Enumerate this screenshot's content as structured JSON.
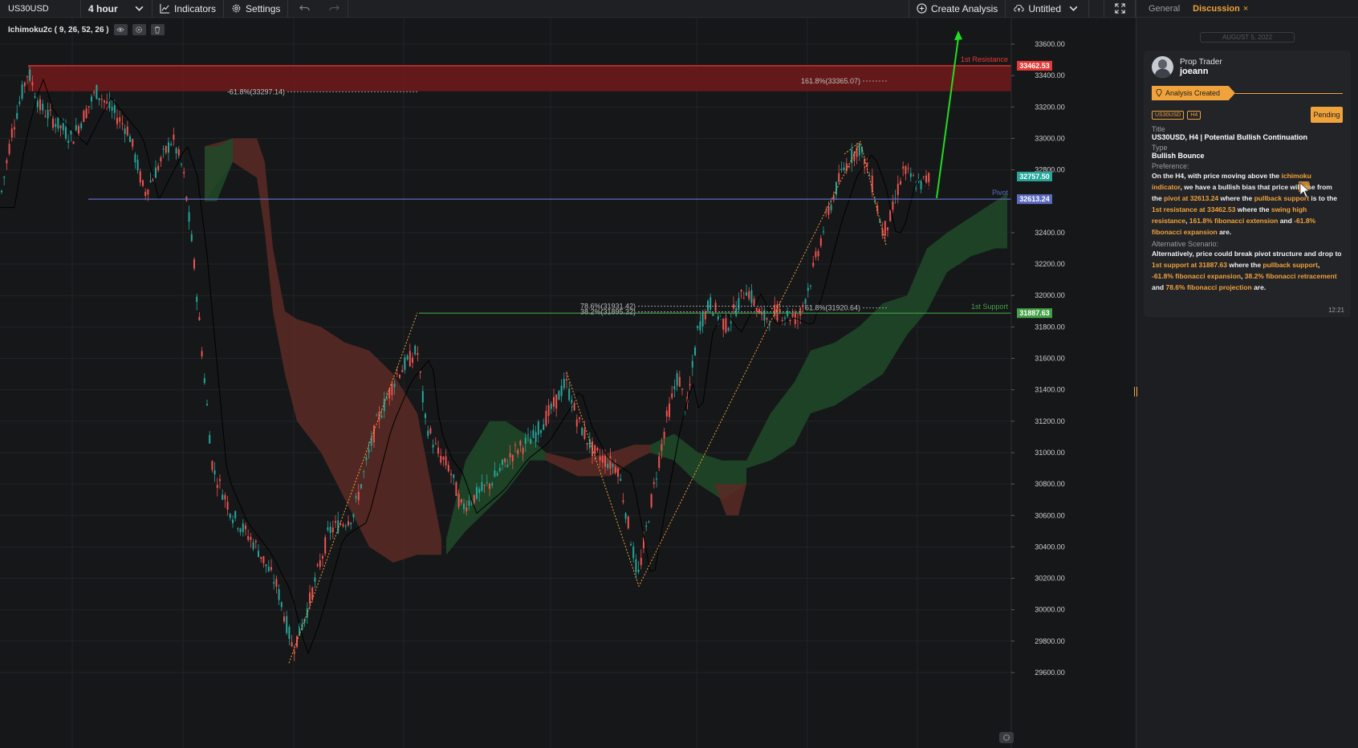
{
  "toolbar": {
    "symbol": "US30USD",
    "interval": "4 hour",
    "indicators_label": "Indicators",
    "settings_label": "Settings",
    "create_analysis_label": "Create Analysis",
    "layout_name": "Untitled"
  },
  "indicator": {
    "label": "Ichimoku2c ( 9, 26, 52, 26 )"
  },
  "chart": {
    "price_ticks": [
      "33600.00",
      "33400.00",
      "33200.00",
      "33000.00",
      "32800.00",
      "32400.00",
      "32200.00",
      "32000.00",
      "31800.00",
      "31600.00",
      "31400.00",
      "31200.00",
      "31000.00",
      "30800.00",
      "30600.00",
      "30400.00",
      "30200.00",
      "30000.00",
      "29800.00",
      "29600.00"
    ],
    "price_tick_values": [
      33600,
      33400,
      33200,
      33000,
      32800,
      32400,
      32200,
      32000,
      31800,
      31600,
      31400,
      31200,
      31000,
      30800,
      30600,
      30400,
      30200,
      30000,
      29800,
      29600
    ],
    "levels": {
      "resistance": {
        "label": "1st Resistance",
        "price_text": "33462.53",
        "value": 33462.53,
        "color": "#e53935"
      },
      "pivot": {
        "label": "Pivot",
        "price_text": "32613.24",
        "value": 32613.24,
        "color": "#5c6bc0"
      },
      "support": {
        "label": "1st Support",
        "price_text": "31887.63",
        "value": 31887.63,
        "color": "#43a047"
      },
      "last_price": {
        "price_text": "32757.50",
        "value": 32757.5,
        "color": "#26a69a"
      }
    },
    "fib_labels": {
      "ext_1618": "161.8%(33365.07)",
      "exp_neg618": "-61.8%(33297.14)",
      "proj_786": "78.6%(31931.42)",
      "ret_382": "38.2%(31895.32)",
      "ext_618": "61.8%(31920.64)"
    },
    "colors": {
      "bull": "#26a69a",
      "bear": "#ef5350",
      "cloud_bull": "#1f4a28",
      "cloud_bear": "#5a2a25",
      "target_arrow": "#22dd22",
      "fib": "#f0a23b"
    }
  },
  "panel": {
    "tabs": {
      "general": "General",
      "discussion": "Discussion",
      "close": "×"
    },
    "date": "AUGUST 5, 2022",
    "author_role": "Prop Trader",
    "author_name": "joeann",
    "status": "Analysis Created",
    "tags": [
      "US30USD",
      "H4"
    ],
    "pending": "Pending",
    "title_label": "Title",
    "title_value": "US30USD, H4 | Potential Bullish Continuation",
    "type_label": "Type",
    "type_value": "Bullish Bounce",
    "preference_label": "Preference:",
    "preference": [
      {
        "t": "On the H4, with price moving above the "
      },
      {
        "t": "ichimoku indicator",
        "h": true
      },
      {
        "t": ", we have a bullish bias that price will rise from the "
      },
      {
        "t": "pivot at 32613.24",
        "h": true
      },
      {
        "t": " where the "
      },
      {
        "t": "pullback support",
        "h": true
      },
      {
        "t": " is to the "
      },
      {
        "t": "1st resistance at 33462.53",
        "h": true
      },
      {
        "t": " where the "
      },
      {
        "t": "swing high resistance",
        "h": true
      },
      {
        "t": ", "
      },
      {
        "t": "161.8% fibonacci extension",
        "h": true
      },
      {
        "t": " and "
      },
      {
        "t": "-61.8% fibonacci expansion",
        "h": true
      },
      {
        "t": " are."
      }
    ],
    "alternative_label": "Alternative Scenario:",
    "alternative": [
      {
        "t": "Alternatively, price could break pivot structure and drop to "
      },
      {
        "t": "1st support at 31887.63",
        "h": true
      },
      {
        "t": " where the "
      },
      {
        "t": "pullback support",
        "h": true
      },
      {
        "t": ", "
      },
      {
        "t": "-61.8% fibonacci expansion",
        "h": true
      },
      {
        "t": ", "
      },
      {
        "t": "38.2% fibonacci retracement",
        "h": true
      },
      {
        "t": " and "
      },
      {
        "t": "78.6% fibonacci projection",
        "h": true
      },
      {
        "t": " are."
      }
    ],
    "time": "12:21"
  }
}
